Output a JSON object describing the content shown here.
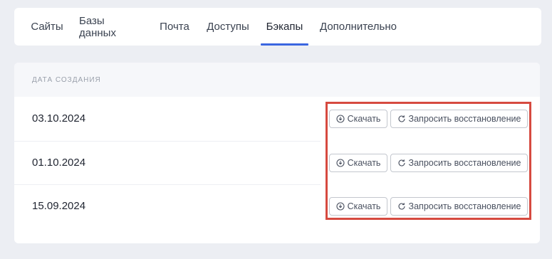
{
  "tabs": [
    {
      "label": "Сайты"
    },
    {
      "label": "Базы данных"
    },
    {
      "label": "Почта"
    },
    {
      "label": "Доступы"
    },
    {
      "label": "Бэкапы",
      "active": true
    },
    {
      "label": "Дополнительно"
    }
  ],
  "table": {
    "header": "ДАТА СОЗДАНИЯ",
    "rows": [
      {
        "date": "03.10.2024",
        "download_label": "Скачать",
        "restore_label": "Запросить восстановление"
      },
      {
        "date": "01.10.2024",
        "download_label": "Скачать",
        "restore_label": "Запросить восстановление"
      },
      {
        "date": "15.09.2024",
        "download_label": "Скачать",
        "restore_label": "Запросить восстановление"
      }
    ]
  },
  "colors": {
    "accent": "#3b66e0",
    "highlight": "#d64a40",
    "background": "#eceef3"
  },
  "icons": {
    "download": "download-circle-icon",
    "restore": "refresh-icon"
  }
}
